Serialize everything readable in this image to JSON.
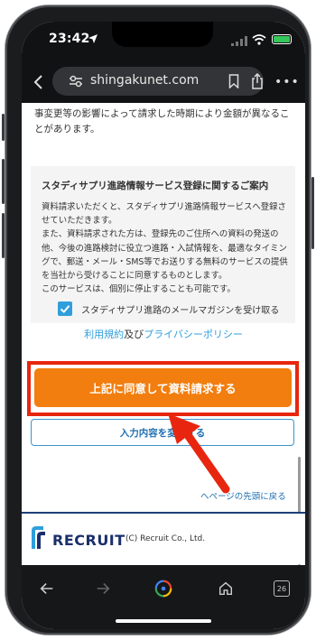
{
  "status_bar": {
    "time": "23:42"
  },
  "address_bar": {
    "url": "shingakunet.com"
  },
  "content": {
    "top_text": "事変更等の影響によって請求した時期により金額が異なることがあります。",
    "notice": {
      "title": "スタディサプリ進路情報サービス登録に関するご案内",
      "body": "資料請求いただくと、スタディサプリ進路情報サービスへ登録させていただきます。\nまた、資料請求された方は、登録先のご住所への資料の発送の他、今後の進路検討に役立つ進路・入試情報を、最適なタイミングで、郵送・メール・SMS等でお送りする無料のサービスの提供を当社から受けることに同意するものとします。\nこのサービスは、個別に停止することも可能です。",
      "checkbox_label": "スタディサプリ進路のメールマガジンを受け取る",
      "checkbox_checked": true
    },
    "terms": {
      "terms_link": "利用規約",
      "connector": "及び",
      "privacy_link": "プライバシーポリシー"
    },
    "primary_button": "上記に同意して資料請求する",
    "secondary_button": "入力内容を変更する",
    "page_top_link": "へページの先頭に戻る"
  },
  "footer": {
    "logo_text": "RECRUIT",
    "copyright": "(C) Recruit Co., Ltd."
  },
  "toolbar": {
    "tabs_count": "26"
  },
  "colors": {
    "accent_orange": "#f27e0f",
    "link_blue": "#2f9fdc",
    "highlight_red": "#e8260f",
    "checkbox_blue": "#2f9fdc"
  },
  "icons": [
    "location-arrow-icon",
    "signal-icon",
    "wifi-icon",
    "battery-icon",
    "back-chevron-icon",
    "site-settings-icon",
    "bookmark-icon",
    "share-icon",
    "more-icon",
    "checkmark-icon",
    "back-arrow-icon",
    "forward-arrow-icon",
    "google-lens-icon",
    "home-icon",
    "tabs-icon",
    "pointer-arrow"
  ]
}
